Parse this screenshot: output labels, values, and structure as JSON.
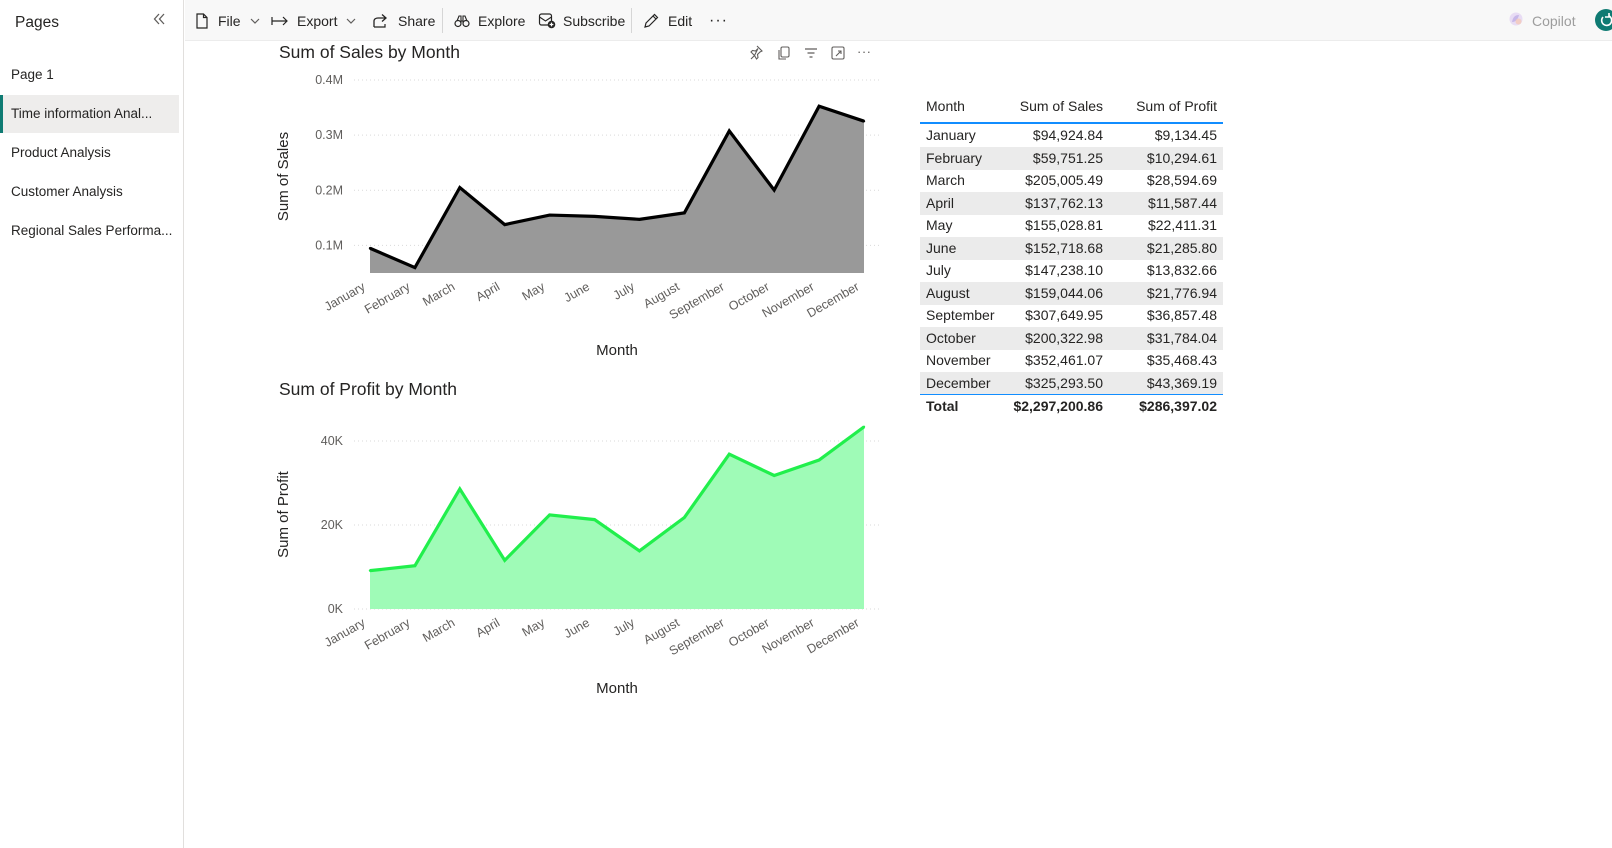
{
  "sidebar": {
    "title": "Pages",
    "items": [
      {
        "label": "Page 1"
      },
      {
        "label": "Time information Anal..."
      },
      {
        "label": "Product Analysis"
      },
      {
        "label": "Customer Analysis"
      },
      {
        "label": "Regional Sales Performa..."
      }
    ],
    "active_index": 1
  },
  "toolbar": {
    "file": "File",
    "export": "Export",
    "share": "Share",
    "explore": "Explore",
    "subscribe": "Subscribe",
    "edit": "Edit",
    "more": "···",
    "copilot": "Copilot"
  },
  "colors": {
    "accent_active": "#0f7b73",
    "table_rule": "#118dff",
    "sales_line": "#000000",
    "sales_fill": "#999999",
    "profit_line": "#21ef4c",
    "profit_fill": "#9ffbb7"
  },
  "chart_data": [
    {
      "type": "area",
      "title": "Sum of Sales by Month",
      "xlabel": "Month",
      "ylabel": "Sum of Sales",
      "categories": [
        "January",
        "February",
        "March",
        "April",
        "May",
        "June",
        "July",
        "August",
        "September",
        "October",
        "November",
        "December"
      ],
      "values": [
        94924.84,
        59751.25,
        205005.49,
        137762.13,
        155028.81,
        152718.68,
        147238.1,
        159044.06,
        307649.95,
        200322.98,
        352461.07,
        325293.5
      ],
      "yticks": [
        "0.1M",
        "0.2M",
        "0.3M",
        "0.4M"
      ],
      "ylim": [
        50000,
        400000
      ],
      "grid": true
    },
    {
      "type": "area",
      "title": "Sum of Profit by Month",
      "xlabel": "Month",
      "ylabel": "Sum of Profit",
      "categories": [
        "January",
        "February",
        "March",
        "April",
        "May",
        "June",
        "July",
        "August",
        "September",
        "October",
        "November",
        "December"
      ],
      "values": [
        9134.45,
        10294.61,
        28594.69,
        11587.44,
        22411.31,
        21285.8,
        13832.66,
        21776.94,
        36857.48,
        31784.04,
        35468.43,
        43369.19
      ],
      "yticks": [
        "0K",
        "20K",
        "40K"
      ],
      "ylim": [
        0,
        45000
      ],
      "grid": true
    }
  ],
  "table": {
    "headers": [
      "Month",
      "Sum of Sales",
      "Sum of Profit"
    ],
    "rows": [
      [
        "January",
        "$94,924.84",
        "$9,134.45"
      ],
      [
        "February",
        "$59,751.25",
        "$10,294.61"
      ],
      [
        "March",
        "$205,005.49",
        "$28,594.69"
      ],
      [
        "April",
        "$137,762.13",
        "$11,587.44"
      ],
      [
        "May",
        "$155,028.81",
        "$22,411.31"
      ],
      [
        "June",
        "$152,718.68",
        "$21,285.80"
      ],
      [
        "July",
        "$147,238.10",
        "$13,832.66"
      ],
      [
        "August",
        "$159,044.06",
        "$21,776.94"
      ],
      [
        "September",
        "$307,649.95",
        "$36,857.48"
      ],
      [
        "October",
        "$200,322.98",
        "$31,784.04"
      ],
      [
        "November",
        "$352,461.07",
        "$35,468.43"
      ],
      [
        "December",
        "$325,293.50",
        "$43,369.19"
      ]
    ],
    "total": [
      "Total",
      "$2,297,200.86",
      "$286,397.02"
    ]
  }
}
